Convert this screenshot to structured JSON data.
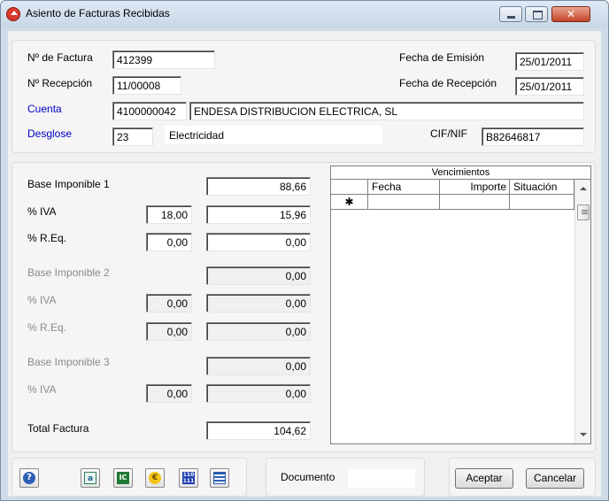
{
  "window": {
    "title": "Asiento de Facturas Recibidas",
    "close_glyph": "✕"
  },
  "header": {
    "factura_label": "Nº de Factura",
    "factura_value": "412399",
    "recepcion_label": "Nº Recepción",
    "recepcion_value": "11/00008",
    "cuenta_label": "Cuenta",
    "cuenta_code": "4100000042",
    "cuenta_name": "ENDESA DISTRIBUCION ELECTRICA, SL",
    "desglose_label": "Desglose",
    "desglose_code": "23",
    "desglose_name": "Electricidad",
    "emision_label": "Fecha de Emisión",
    "emision_value": "25/01/2011",
    "fecha_recepcion_label": "Fecha de Recepción",
    "fecha_recepcion_value": "25/01/2011",
    "cif_label": "CIF/NIF",
    "cif_value": "B82646817"
  },
  "taxes": {
    "base1_label": "Base Imponible 1",
    "base1_value": "88,66",
    "iva1_label": "% IVA",
    "iva1_pct": "18,00",
    "iva1_value": "15,96",
    "req1_label": "% R.Eq.",
    "req1_pct": "0,00",
    "req1_value": "0,00",
    "base2_label": "Base Imponible 2",
    "base2_value": "0,00",
    "iva2_label": "% IVA",
    "iva2_pct": "0,00",
    "iva2_value": "0,00",
    "req2_label": "% R.Eq.",
    "req2_pct": "0,00",
    "req2_value": "0,00",
    "base3_label": "Base Imponible 3",
    "base3_value": "0,00",
    "iva3_label": "% IVA",
    "iva3_pct": "0,00",
    "iva3_value": "0,00",
    "total_label": "Total Factura",
    "total_value": "104,62"
  },
  "vencimientos": {
    "caption": "Vencimientos",
    "columns": [
      "Fecha",
      "Importe",
      "Situación"
    ],
    "new_row_marker": "✱"
  },
  "toolbar": {
    "icons": [
      "help-icon",
      "a-icon",
      "ic-icon",
      "euro-icon",
      "binary-icon",
      "list-icon"
    ],
    "ic_text": "IC",
    "a_text": "a",
    "euro_text": "€",
    "binary_text": "110\n111"
  },
  "footer": {
    "documento_label": "Documento",
    "documento_value": "",
    "aceptar_label": "Aceptar",
    "cancelar_label": "Cancelar"
  }
}
